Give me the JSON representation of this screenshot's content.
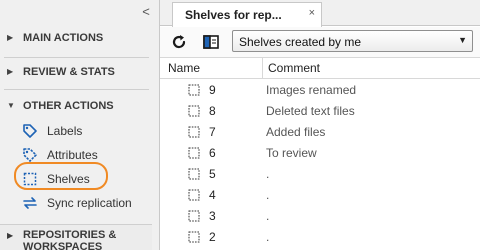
{
  "sidebar": {
    "collapse_glyph": "<",
    "sections": {
      "main_actions": "MAIN ACTIONS",
      "review_stats": "REVIEW & STATS",
      "other_actions": "OTHER ACTIONS",
      "repositories": "REPOSITORIES & WORKSPACES"
    },
    "items": [
      {
        "label": "Labels",
        "icon": "label-tag-icon"
      },
      {
        "label": "Attributes",
        "icon": "attribute-tag-icon"
      },
      {
        "label": "Shelves",
        "icon": "shelve-icon"
      },
      {
        "label": "Sync replication",
        "icon": "sync-icon"
      }
    ],
    "highlight_color": "#f08a24"
  },
  "tab": {
    "title": "Shelves for rep...",
    "close": "×"
  },
  "toolbar": {
    "filter_value": "Shelves created by me"
  },
  "table": {
    "headers": {
      "name": "Name",
      "comment": "Comment"
    },
    "rows": [
      {
        "name": "9",
        "comment": "Images renamed"
      },
      {
        "name": "8",
        "comment": "Deleted text files"
      },
      {
        "name": "7",
        "comment": "Added files"
      },
      {
        "name": "6",
        "comment": "To review"
      },
      {
        "name": "5",
        "comment": "."
      },
      {
        "name": "4",
        "comment": "."
      },
      {
        "name": "3",
        "comment": "."
      },
      {
        "name": "2",
        "comment": "."
      }
    ]
  },
  "colors": {
    "accent": "#1e63b5",
    "sidebar_bg": "#f0f0f0"
  }
}
